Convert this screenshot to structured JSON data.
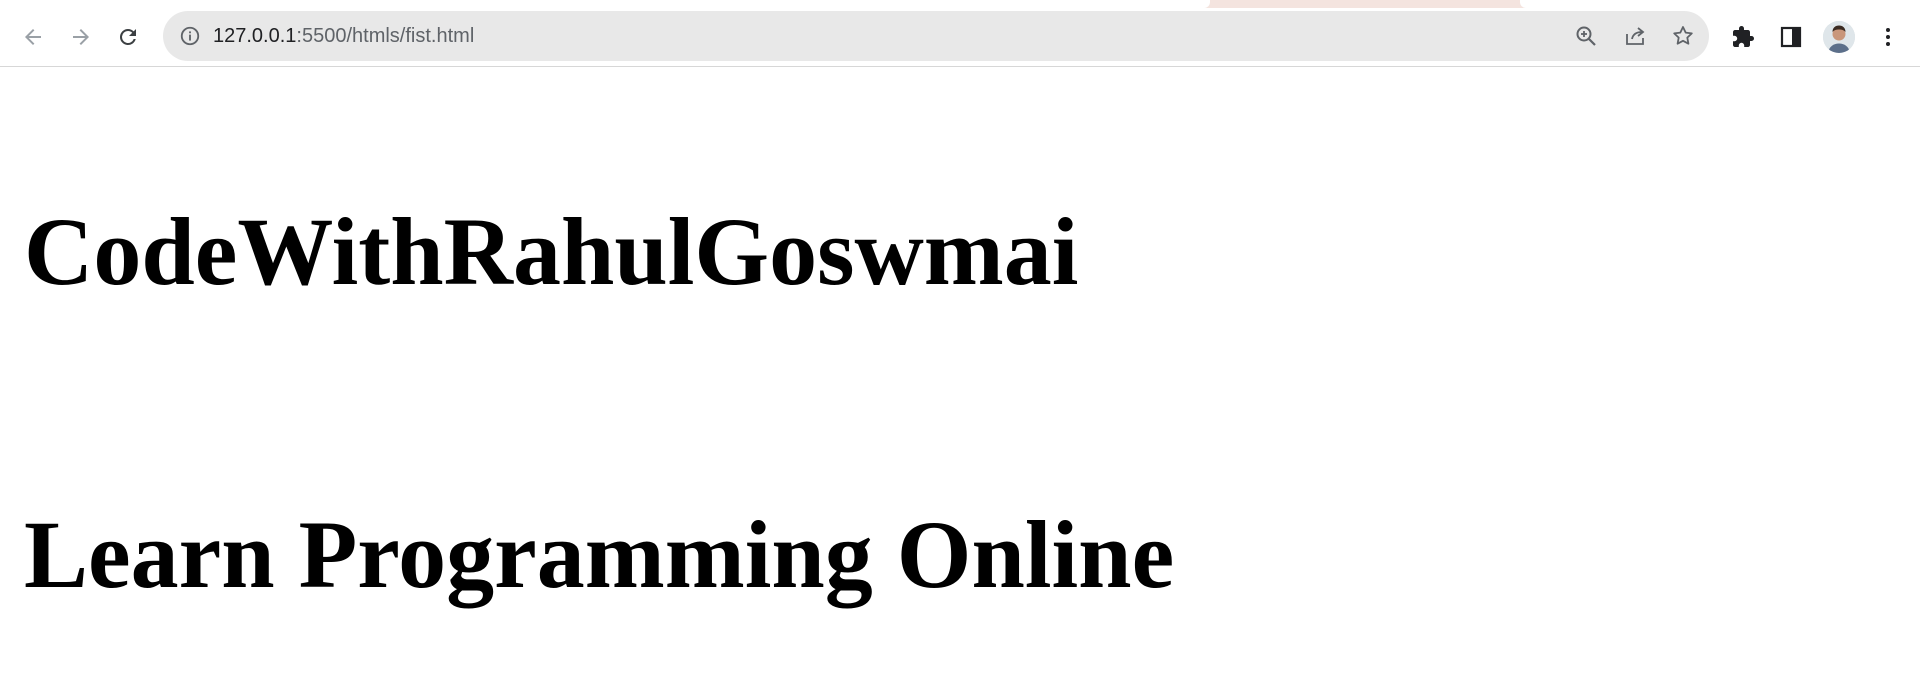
{
  "browser": {
    "url_host": "127.0.0.1",
    "url_rest": ":5500/htmls/fist.html"
  },
  "icons": {
    "back": "arrow-left-icon",
    "forward": "arrow-right-icon",
    "reload": "reload-icon",
    "site_info": "info-icon",
    "zoom": "zoom-in-icon",
    "share": "share-icon",
    "bookmark": "star-icon",
    "extensions": "puzzle-icon",
    "side_panel": "side-panel-icon",
    "menu": "kebab-menu-icon"
  },
  "colors": {
    "omnibox_bg": "#e8e8e8",
    "icon": "#5f6368",
    "text": "#000000"
  },
  "page": {
    "heading1": "CodeWithRahulGoswmai",
    "heading2": "Learn Programming Online"
  }
}
